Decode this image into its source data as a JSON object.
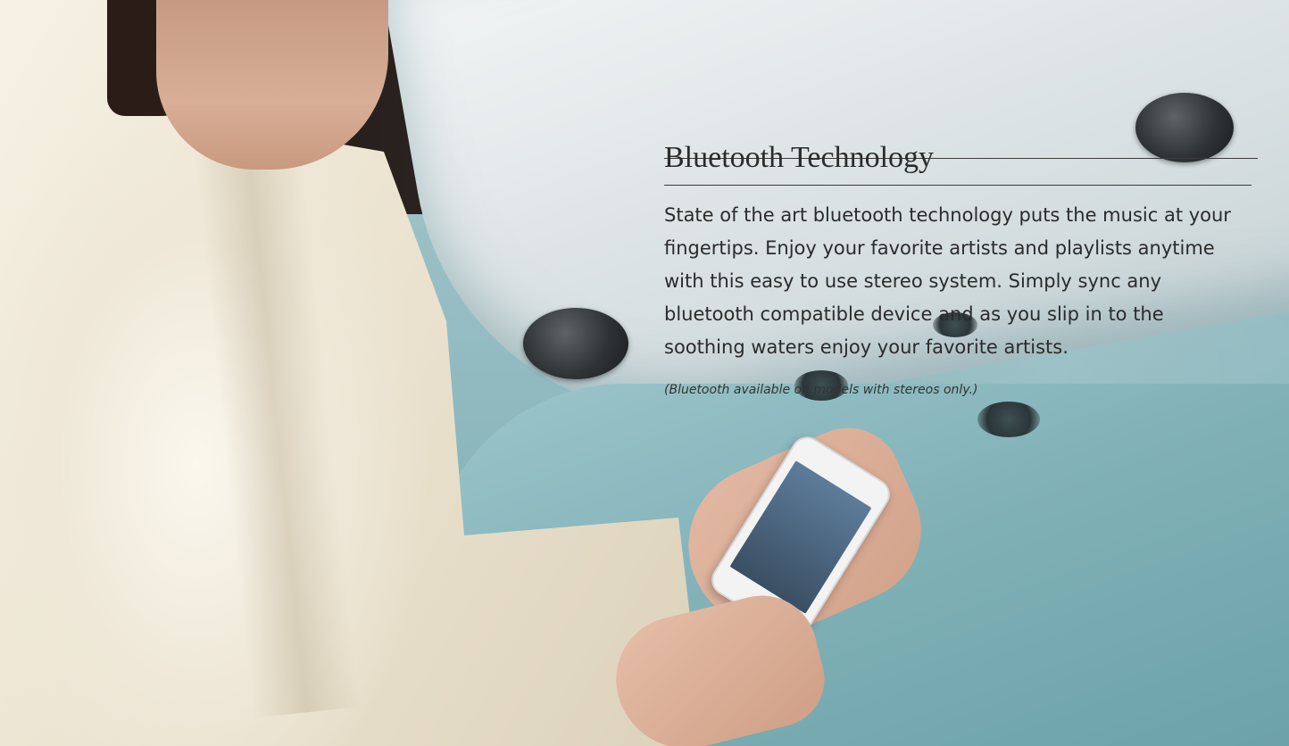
{
  "feature": {
    "title": "Bluetooth Technology",
    "body_lines": [
      "State of the art bluetooth technology puts the music at your",
      "fingertips. Enjoy your favorite artists and playlists anytime",
      "with this easy to use stereo system. Simply sync any",
      "bluetooth compatible device and as you slip in to the",
      "soothing waters enjoy your favorite artists."
    ],
    "footnote": "(Bluetooth available on models with stereos only.)"
  },
  "colors": {
    "text": "#2b2b2b",
    "rule": "#3a3a3a",
    "water": "#8fb9bf",
    "robe": "#f3ecdd"
  }
}
